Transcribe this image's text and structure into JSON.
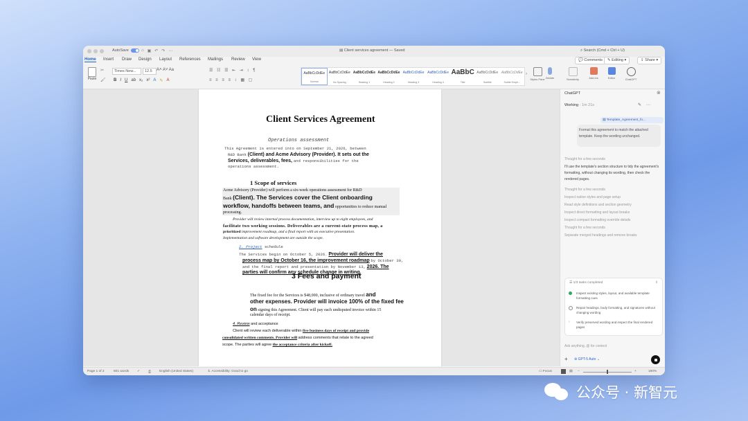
{
  "window": {
    "autosave_label": "AutoSave",
    "doc_title": "Client services agreement — Saved",
    "search_placeholder": "Search (Cmd + Ctrl + U)"
  },
  "tabs": [
    "Home",
    "Insert",
    "Draw",
    "Design",
    "Layout",
    "References",
    "Mailings",
    "Review",
    "View"
  ],
  "ribbon_buttons": {
    "comments": "Comments",
    "editing": "Editing",
    "share": "Share"
  },
  "ribbon": {
    "paste": "Paste",
    "font": "Times New...",
    "size": "12.5",
    "styles": [
      {
        "preview": "AaBbCcDdEe",
        "name": "Normal"
      },
      {
        "preview": "AaBbCcDdEe",
        "name": "No Spacing"
      },
      {
        "preview": "AaBbCcDdEe",
        "name": "Heading 1"
      },
      {
        "preview": "AaBbCcDdEe",
        "name": "Heading 2"
      },
      {
        "preview": "AaBbCcDdEe",
        "name": "Heading 3"
      },
      {
        "preview": "AaBbCcDdEe",
        "name": "Heading 4"
      },
      {
        "preview": "AaBbC",
        "name": "Title"
      },
      {
        "preview": "AaBbCcDdEe",
        "name": "Subtitle"
      },
      {
        "preview": "AaBbCcDdEe",
        "name": "Subtle Emph..."
      }
    ],
    "tools": [
      "Styles Pane",
      "Dictate",
      "Sensitivity",
      "Add-ins",
      "Editor",
      "ChatGPT"
    ]
  },
  "document": {
    "title": "Client Services Agreement",
    "subtitle": "Operations assessment",
    "intro_1": "This Agreement is entered into on September 21, 2026, between",
    "intro_2a": "R&D Bank",
    "intro_2b": "(Client) and Acme Advisory (Provider). It sets out the",
    "intro_3a": "Services, deliverables, fees,",
    "intro_3b": "and responsibilities for the",
    "intro_4": "operations assessment.",
    "h1": "1  Scope of services",
    "p1_1": "Acme Advisory (Provider) will perform a six-week operations assessment for R&D",
    "p1_2a": "Bank",
    "p1_2b": "(Client). The Services cover the Client onboarding",
    "p1_3a": "workflow, handoffs between teams, and",
    "p1_3b": "opportunities to reduce manual",
    "p1_4": "processing.",
    "p2_1": "Provider will review internal process documentation, interview up to eight employees, and",
    "p2_2": "facilitate two working sessions. Deliverables are a current-state process map, a",
    "p2_3a": "prioritized",
    "p2_3b": "improvement roadmap, and a final report with an executive presentation.",
    "p2_4": "Implementation and software development are outside the scope.",
    "h2a": "2. Project",
    "h2b": "schedule",
    "s1a": "The Services begin on October 5, 2026.",
    "s1b": "Provider will deliver the",
    "s2a": "process map by October 16, the improvement roadmap",
    "s2b": "by October 30,",
    "s3a": "and the final report and presentation by November 13,",
    "s3b": "2026. The",
    "s4": "parties will confirm any schedule change in writing.",
    "h3": "3  Fees and payment",
    "f1a": "The fixed fee for the Services is $48,000, inclusive of ordinary travel",
    "f1b": "and",
    "f2": "other expenses. Provider will invoice 100% of the fixed fee",
    "f3a": "on",
    "f3b": "signing this Agreement. Client will pay each undisputed invoice within 15",
    "f4": "calendar days of receipt.",
    "h4a": "4. Review",
    "h4b": "and acceptance",
    "r1a": "Client will review each deliverable within",
    "r1b": "five business days of receipt and provide",
    "r2a": "consolidated written comments. Provider will",
    "r2b": "address comments that relate to the agreed",
    "r3a": "scope. The parties will agree",
    "r3b": "the acceptance criteria after kickoff."
  },
  "panel": {
    "title": "ChatGPT",
    "working": "Working",
    "elapsed": "1m 21s",
    "attachment": "Template_Agreement_fo...",
    "user_message": "Format this agreement to match the attached template. Keep the wording unchanged.",
    "thought_1": "Thought for a few seconds",
    "reply": "I'll use the template's section structure to tidy the agreement's formatting, without changing its wording, then check the rendered pages.",
    "log": [
      "Thought for a few seconds",
      "Inspect native styles and page setup",
      "Read style definitions and section geometry",
      "Inspect direct formatting and layout breaks",
      "Inspect compact formatting override details",
      "Thought for a few seconds",
      "Separate merged headings and remove breaks"
    ],
    "tasks_header": "1/3 tasks completed",
    "tasks": [
      {
        "text": "Inspect existing styles, layout, and available template formatting cues",
        "state": "done"
      },
      {
        "text": "Repair headings, body formatting, and signatures without changing wording",
        "state": "active"
      },
      {
        "text": "Verify preserved wording and inspect the final rendered pages",
        "state": "todo"
      }
    ],
    "input_placeholder": "Ask anything, @ for context",
    "model": "GPT-5 Auto"
  },
  "statusbar": {
    "page": "Page 1 of 2",
    "words": "601 words",
    "language": "English (United States)",
    "accessibility": "Accessibility: Good to go",
    "focus": "Focus",
    "zoom": "180%"
  },
  "watermark": "公众号 · 新智元",
  "colors": {
    "accent": "#1f5fc7",
    "done": "#2fa866",
    "background": "#8fb3f0"
  }
}
